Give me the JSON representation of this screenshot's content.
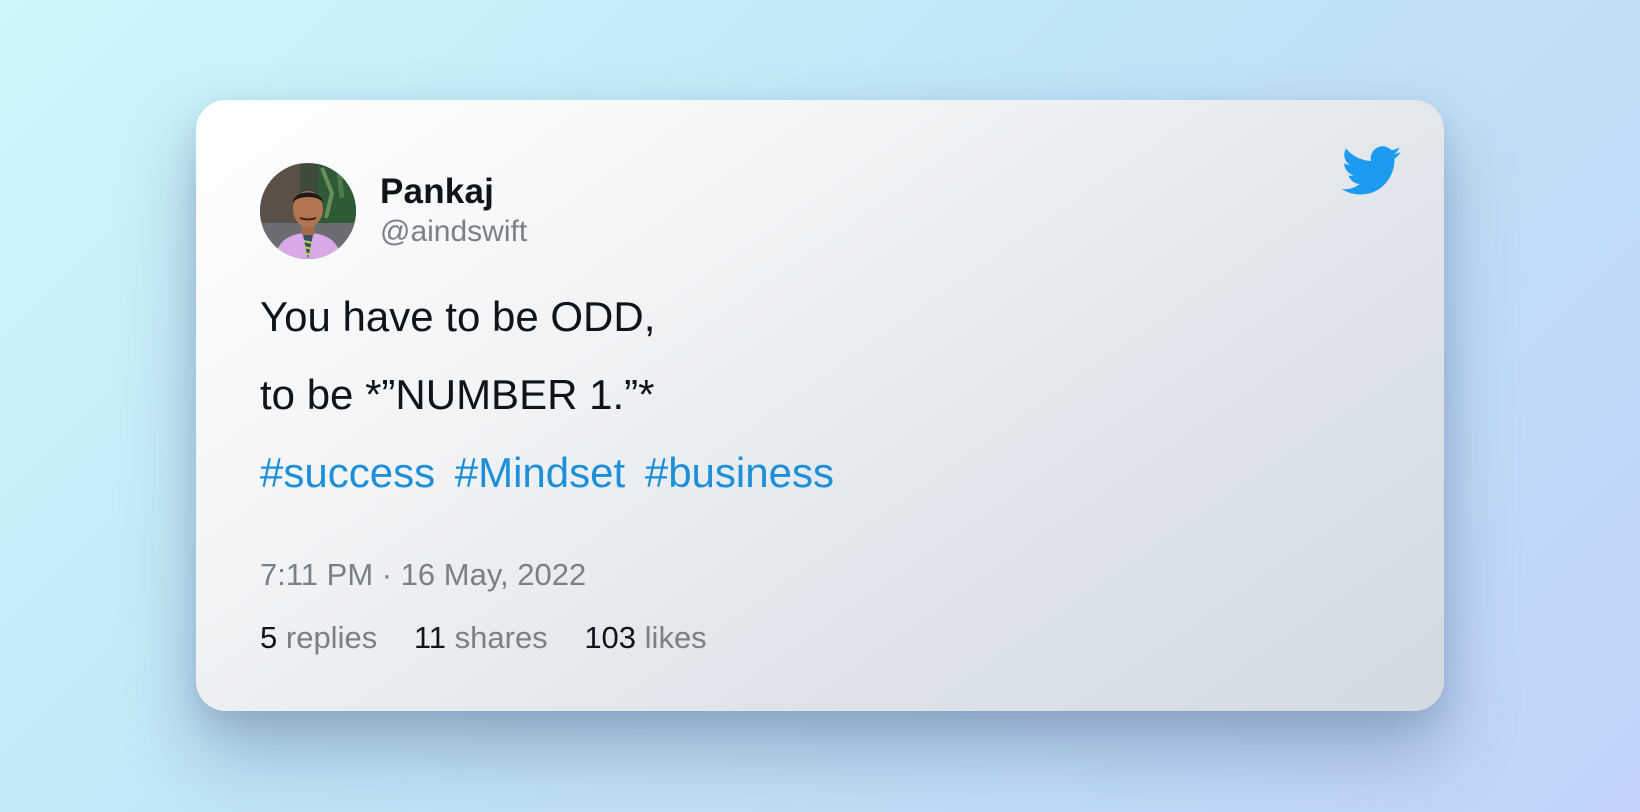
{
  "author": {
    "name": "Pankaj",
    "handle": "@aindswift"
  },
  "tweet": {
    "line1": "You have to be ODD,",
    "line2": "to be *”NUMBER 1.”*",
    "hashtags": [
      "#success",
      "#Mindset",
      "#business"
    ]
  },
  "meta": {
    "timestamp": "7:11 PM · 16 May, 2022"
  },
  "stats": {
    "replies": {
      "count": "5",
      "label": "replies"
    },
    "shares": {
      "count": "11",
      "label": "shares"
    },
    "likes": {
      "count": "103",
      "label": "likes"
    }
  },
  "icons": {
    "brand": "twitter-bird-icon"
  },
  "colors": {
    "hashtag": "#1d8fd8",
    "twitter_blue": "#1d9bf0",
    "text_primary": "#0f1419",
    "text_secondary": "#7b8085"
  }
}
